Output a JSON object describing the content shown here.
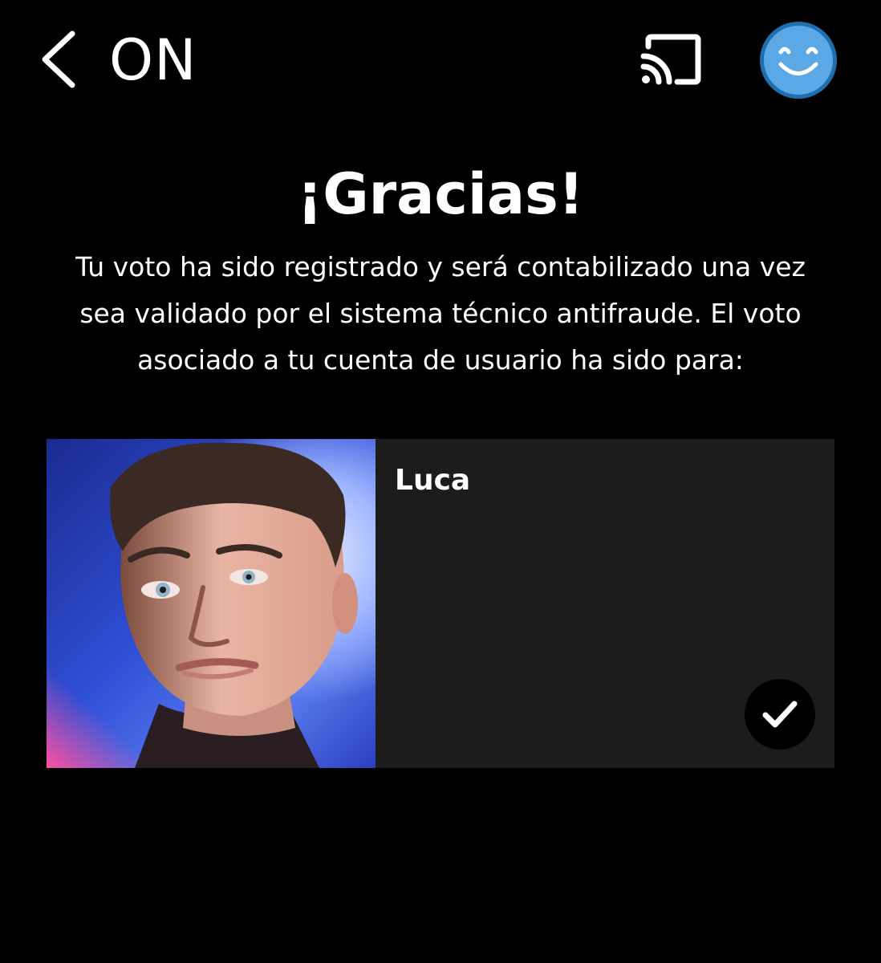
{
  "header": {
    "title": "ON",
    "back_icon": "chevron-left-icon",
    "cast_icon": "cast-icon",
    "avatar_icon": "smiley-face-icon"
  },
  "confirmation": {
    "headline": "¡Gracias!",
    "message_lines": [
      "Tu voto ha sido registrado y será contabilizado una vez",
      "sea validado por el sistema técnico antifraude. El voto",
      "asociado a tu cuenta de usuario ha sido para:"
    ]
  },
  "candidate": {
    "name": "Luca",
    "selected": true,
    "selected_icon": "checkmark-icon"
  },
  "colors": {
    "background": "#000000",
    "card": "#1c1c1c",
    "text": "#ffffff",
    "avatar_fill": "#5aa8e6",
    "avatar_ring": "#1f6fb0"
  }
}
